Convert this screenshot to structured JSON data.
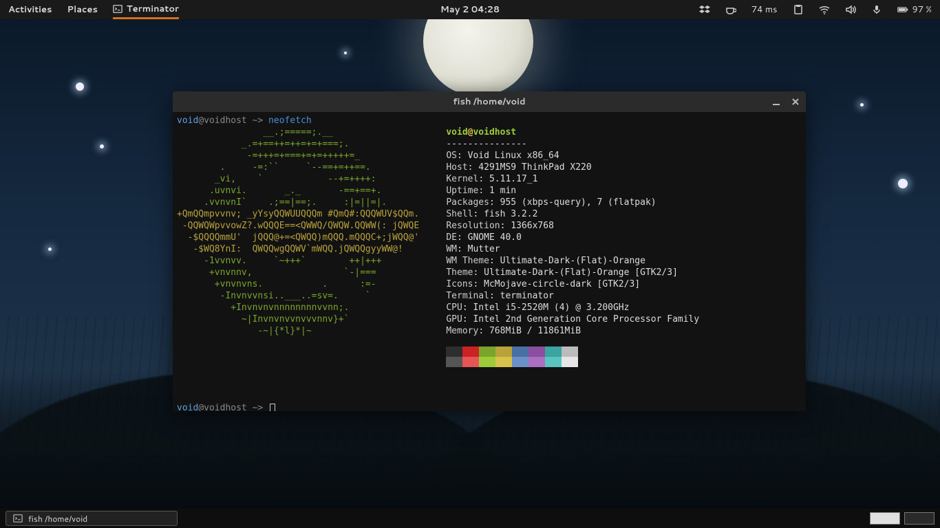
{
  "topbar": {
    "activities": "Activities",
    "places": "Places",
    "app_name": "Terminator",
    "clock": "May 2  04:28",
    "latency": "74 ms",
    "battery": "97 %"
  },
  "terminal": {
    "window_title": "fish /home/void",
    "prompt_user": "void",
    "prompt_sep": "@voidhost ~> ",
    "command": "neofetch",
    "ascii": [
      "                __.;=====;.__",
      "            _.=+==++=++=+=+===;.",
      "             -=+++=+===+=+=+++++=_",
      "        .     -=:``     `--==+=++==.",
      "       _vi,    `            --+=++++:",
      "      .uvnvi.       _._       -==+==+.",
      "     .vvnvnI`    .;==|==;.     :|=||=|.",
      "+QmQQmpvvnv; _yYsyQQWUUQQQm #QmQ#:QQQWUV$QQm.",
      " -QQWQWpvvowZ?.wQQQE==<QWWQ/QWQW.QQWW(: jQWQE",
      "  -$QQQQmmU'  jQQQ@+=<QWQQ)mQQQ.mQQQC+;jWQQ@'",
      "   -$WQ8YnI:  QWQQwgQQWV`mWQQ.jQWQQgyyWW@!",
      "     -1vvnvv.     `~+++`        ++|+++",
      "      +vnvnnv,                 `-|===",
      "       +vnvnvns.           .      :=-",
      "        -Invnvvnsi..___..=sv=.     `",
      "          +Invnvnvnnnnnnnnvvnn;.",
      "            ~|Invnvnvvnvvvnnv}+`",
      "               -~|{*l}*|~"
    ],
    "header_user": "void",
    "header_at": "@",
    "header_host": "voidhost",
    "dashes": "---------------",
    "info": [
      {
        "k": "OS",
        "v": "Void Linux x86_64"
      },
      {
        "k": "Host",
        "v": "4291MS9 ThinkPad X220"
      },
      {
        "k": "Kernel",
        "v": "5.11.17_1"
      },
      {
        "k": "Uptime",
        "v": "1 min"
      },
      {
        "k": "Packages",
        "v": "955 (xbps-query), 7 (flatpak)"
      },
      {
        "k": "Shell",
        "v": "fish 3.2.2"
      },
      {
        "k": "Resolution",
        "v": "1366x768"
      },
      {
        "k": "DE",
        "v": "GNOME 40.0"
      },
      {
        "k": "WM",
        "v": "Mutter"
      },
      {
        "k": "WM Theme",
        "v": "Ultimate-Dark-(Flat)-Orange"
      },
      {
        "k": "Theme",
        "v": "Ultimate-Dark-(Flat)-Orange [GTK2/3]"
      },
      {
        "k": "Icons",
        "v": "McMojave-circle-dark [GTK2/3]"
      },
      {
        "k": "Terminal",
        "v": "terminator"
      },
      {
        "k": "CPU",
        "v": "Intel i5-2520M (4) @ 3.200GHz"
      },
      {
        "k": "GPU",
        "v": "Intel 2nd Generation Core Processor Family"
      },
      {
        "k": "Memory",
        "v": "768MiB / 11861MiB"
      }
    ],
    "swatches_dark": [
      "#2e2e2e",
      "#cc2222",
      "#7aa52b",
      "#b8a23a",
      "#4a6fa5",
      "#8a4fa0",
      "#3aa5a0",
      "#bcbcbc"
    ],
    "swatches_light": [
      "#555555",
      "#e65555",
      "#9ecb3a",
      "#d9c24a",
      "#6a90c5",
      "#aa6fc0",
      "#5ac5c0",
      "#e6e6e6"
    ]
  },
  "taskbar": {
    "entry_label": "fish /home/void"
  }
}
